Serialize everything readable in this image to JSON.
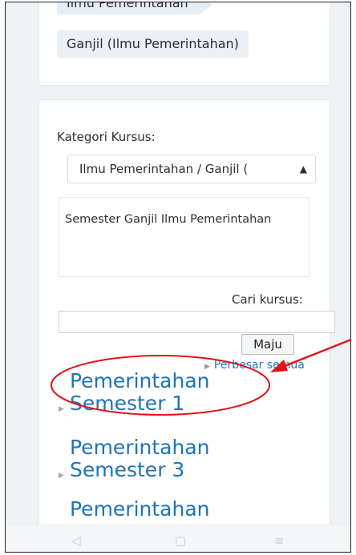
{
  "top_card": {
    "breadcrumb_1": "Ilmu Pemerintahan",
    "breadcrumb_2": "Ganjil (Ilmu Pemerintahan)"
  },
  "main_card": {
    "category_label": "Kategori Kursus:",
    "category_select_value": "Ilmu Pemerintahan / Ganjil (",
    "category_description": "Semester Ganjil Ilmu Pemerintahan",
    "search_label": "Cari kursus:",
    "search_value": "",
    "go_button": "Maju",
    "expand_all": "Perbesar semua",
    "courses": [
      {
        "line1": "Pemerintahan",
        "line2": "Semester 1"
      },
      {
        "line1": "Pemerintahan",
        "line2": "Semester 3"
      },
      {
        "line1": "Pemerintahan",
        "line2": ""
      }
    ]
  },
  "nav": {
    "back_icon": "triangle-back-icon",
    "home_icon": "square-home-icon",
    "menu_icon": "hamburger-menu-icon"
  },
  "annotation_color": "#e3121b"
}
